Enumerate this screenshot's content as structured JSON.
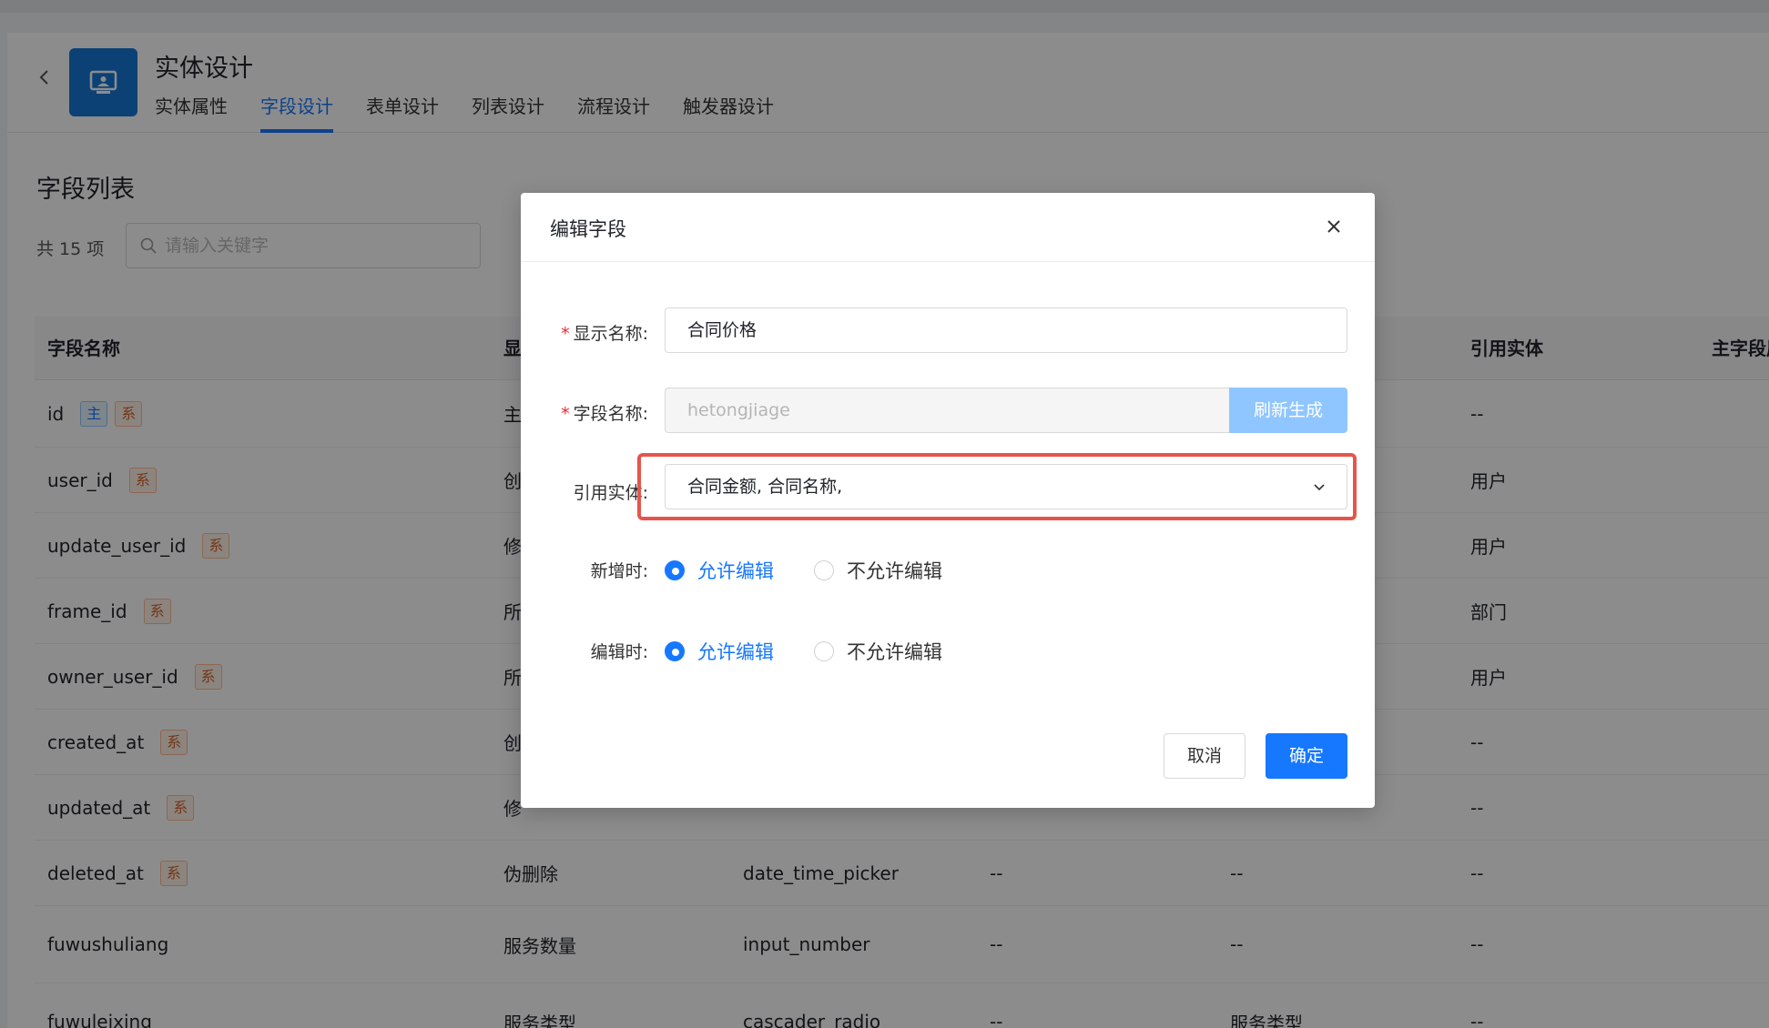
{
  "header": {
    "title": "实体设计",
    "tabs": [
      "实体属性",
      "字段设计",
      "表单设计",
      "列表设计",
      "流程设计",
      "触发器设计"
    ],
    "active_tab": "字段设计"
  },
  "list": {
    "title": "字段列表",
    "count": "共 15 项",
    "search_placeholder": "请输入关键字",
    "columns": [
      "字段名称",
      "显",
      "引用实体",
      "主字段展"
    ],
    "rows": [
      {
        "name": "id",
        "tags": [
          "主",
          "系"
        ],
        "display": "主",
        "component": "",
        "c4": "",
        "c5": "",
        "ref": "--"
      },
      {
        "name": "user_id",
        "tags": [
          "系"
        ],
        "display": "创",
        "component": "",
        "c4": "",
        "c5": "",
        "ref": "用户"
      },
      {
        "name": "update_user_id",
        "tags": [
          "系"
        ],
        "display": "修",
        "component": "",
        "c4": "",
        "c5": "",
        "ref": "用户"
      },
      {
        "name": "frame_id",
        "tags": [
          "系"
        ],
        "display": "所",
        "component": "",
        "c4": "",
        "c5": "",
        "ref": "部门"
      },
      {
        "name": "owner_user_id",
        "tags": [
          "系"
        ],
        "display": "所",
        "component": "",
        "c4": "",
        "c5": "",
        "ref": "用户"
      },
      {
        "name": "created_at",
        "tags": [
          "系"
        ],
        "display": "创",
        "component": "",
        "c4": "",
        "c5": "",
        "ref": "--"
      },
      {
        "name": "updated_at",
        "tags": [
          "系"
        ],
        "display": "修",
        "component": "",
        "c4": "",
        "c5": "",
        "ref": "--"
      },
      {
        "name": "deleted_at",
        "tags": [
          "系"
        ],
        "display": "伪删除",
        "component": "date_time_picker",
        "c4": "--",
        "c5": "--",
        "ref": "--"
      },
      {
        "name": "fuwushuliang",
        "tags": [],
        "display": "服务数量",
        "component": "input_number",
        "c4": "--",
        "c5": "--",
        "ref": "--"
      },
      {
        "name": "fuwuleixing",
        "tags": [],
        "display": "服务类型",
        "component": "cascader_radio",
        "c4": "--",
        "c5": "服务类型",
        "ref": "--"
      }
    ]
  },
  "modal": {
    "title": "编辑字段",
    "display_name_label": "显示名称:",
    "display_name_value": "合同价格",
    "field_name_label": "字段名称:",
    "field_name_value": "hetongjiage",
    "refresh_label": "刷新生成",
    "ref_entity_label": "引用实体:",
    "ref_entity_value": "合同金额, 合同名称,",
    "on_create_label": "新增时:",
    "on_edit_label": "编辑时:",
    "allow_label": "允许编辑",
    "disallow_label": "不允许编辑",
    "on_create_selected": "允许编辑",
    "on_edit_selected": "允许编辑",
    "cancel_label": "取消",
    "ok_label": "确定"
  },
  "colors": {
    "primary": "#1677ff",
    "tag_main": "#1677ff",
    "tag_sys": "#d4622a",
    "highlight": "#e5544b"
  }
}
